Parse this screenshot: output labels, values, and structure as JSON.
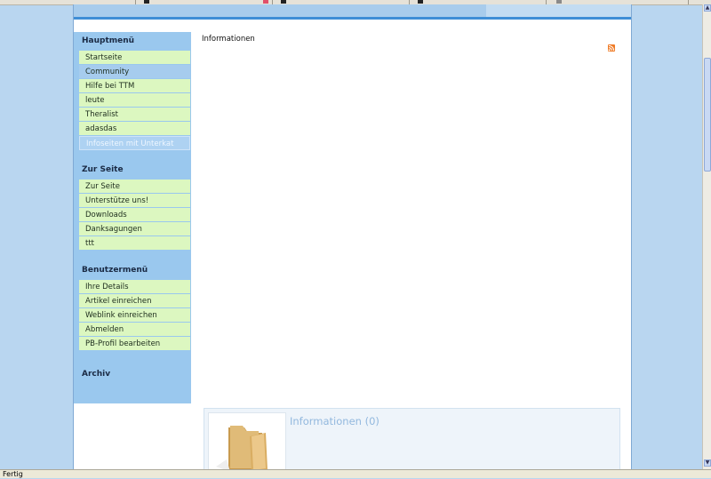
{
  "sidebar": {
    "main_menu": {
      "title": "Hauptmenü",
      "items": [
        "Startseite",
        "Community",
        "Hilfe bei TTM",
        "leute",
        "Theralist",
        "adasdas",
        "Infoseiten mit Unterkat"
      ]
    },
    "site_menu": {
      "title": "Zur Seite",
      "items": [
        "Zur Seite",
        "Unterstütze uns!",
        "Downloads",
        "Danksagungen",
        "ttt"
      ]
    },
    "user_menu": {
      "title": "Benutzermenü",
      "items": [
        "Ihre Details",
        "Artikel einreichen",
        "Weblink einreichen",
        "Abmelden",
        "PB-Profil bearbeiten"
      ]
    },
    "archive": {
      "title": "Archiv"
    }
  },
  "content": {
    "page_title": "Informationen",
    "category": {
      "title": "Informationen (0)"
    }
  },
  "status_bar": {
    "text": "Fertig"
  },
  "colors": {
    "sidebar_bg": "#9ac8ee",
    "menu_item_bg": "#dcf7c0",
    "accent_line": "#3f8ed6",
    "rss": "#ef7b26",
    "category_title": "#92b8de"
  },
  "icons": {
    "rss": "rss-feed-icon",
    "folder": "folder-icon"
  }
}
